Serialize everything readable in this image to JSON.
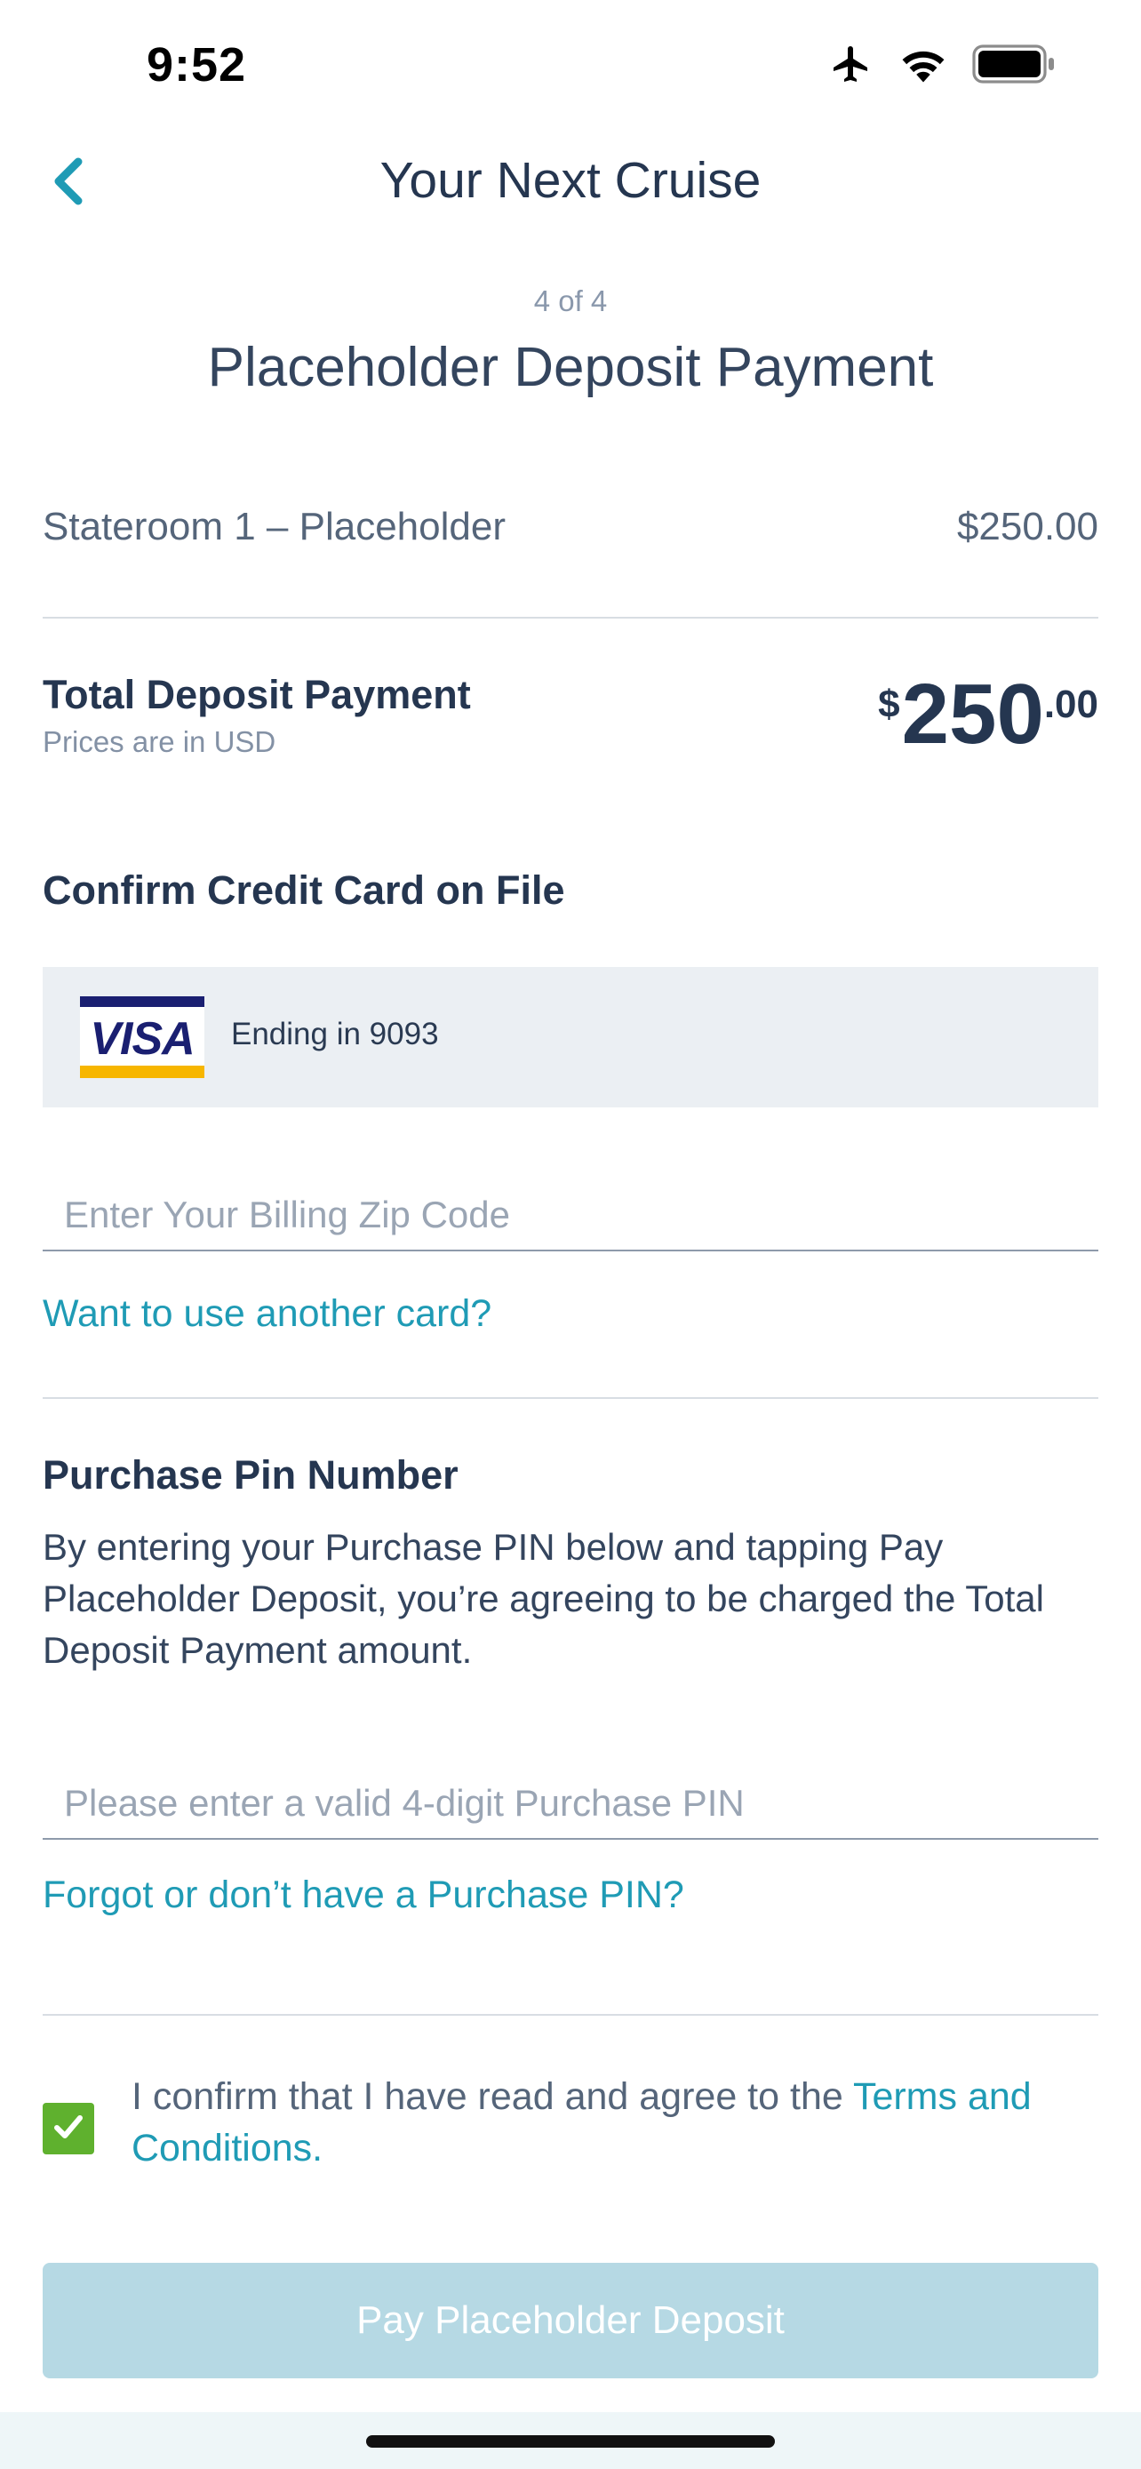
{
  "status_bar": {
    "time": "9:52",
    "icons": [
      "airplane-icon",
      "wifi-icon",
      "battery-icon"
    ]
  },
  "header": {
    "title": "Your Next Cruise",
    "back_icon": "chevron-left-icon"
  },
  "step": {
    "indicator": "4 of 4",
    "title": "Placeholder Deposit Payment"
  },
  "line_item": {
    "label": "Stateroom 1 – Placeholder",
    "amount": "$250.00"
  },
  "total": {
    "label": "Total Deposit Payment",
    "subtext": "Prices are in USD",
    "currency": "$",
    "whole": "250",
    "cents": ".00"
  },
  "card_section": {
    "heading": "Confirm Credit Card on File",
    "card_brand": "VISA",
    "card_text": "Ending in 9093",
    "zip_placeholder": "Enter Your Billing Zip Code",
    "zip_value": "",
    "another_card_link": "Want to use another card?"
  },
  "pin_section": {
    "heading": "Purchase Pin Number",
    "description": "By entering your Purchase PIN below and tapping Pay Placeholder Deposit, you’re agreeing to be charged the Total Deposit Payment amount.",
    "pin_placeholder": "Please enter a valid 4-digit Purchase PIN",
    "pin_value": "",
    "forgot_link": "Forgot or don’t have a Purchase PIN?"
  },
  "confirm": {
    "checked": true,
    "text": "I confirm that I have read and agree to the ",
    "terms_link": "Terms and Conditions."
  },
  "pay_button": {
    "label": "Pay Placeholder Deposit"
  },
  "colors": {
    "accent": "#1f9bb5",
    "text_dark": "#253650",
    "checkbox": "#5fb12e",
    "button_disabled": "#b6d9e4",
    "card_bg": "#ebeff3"
  }
}
